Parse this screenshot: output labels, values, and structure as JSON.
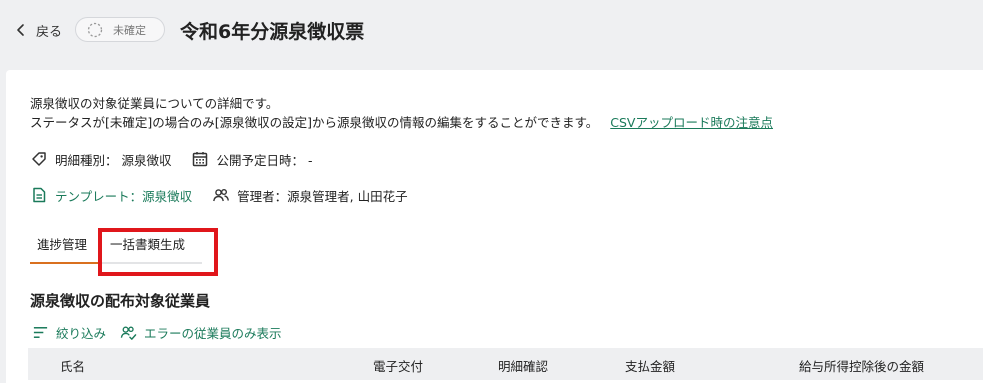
{
  "header": {
    "back_label": "戻る",
    "status_badge": "未確定",
    "title": "令和6年分源泉徴収票"
  },
  "description": {
    "line1": "源泉徴収の対象従業員についての詳細です。",
    "line2": "ステータスが[未確定]の場合のみ[源泉徴収の設定]から源泉徴収の情報の編集をすることができます。",
    "csv_link": "CSVアップロード時の注意点"
  },
  "meta": {
    "detail_type": "明細種別： 源泉徴収",
    "publish_date": "公開予定日時： -",
    "template": "テンプレート：源泉徴収",
    "managers": "管理者：源泉管理者, 山田花子"
  },
  "tabs": [
    {
      "label": "進捗管理",
      "active": true
    },
    {
      "label": "一括書類生成",
      "active": false
    }
  ],
  "section": {
    "title": "源泉徴収の配布対象従業員",
    "filter_label": "絞り込み",
    "error_filter_label": "エラーの従業員のみ表示"
  },
  "table": {
    "columns": [
      "氏名",
      "電子交付",
      "明細確認",
      "支払金額",
      "給与所得控除後の金額"
    ]
  },
  "colors": {
    "accent_green": "#1a7a5a",
    "tab_active": "#d9701f",
    "highlight_box": "#e0161b"
  }
}
